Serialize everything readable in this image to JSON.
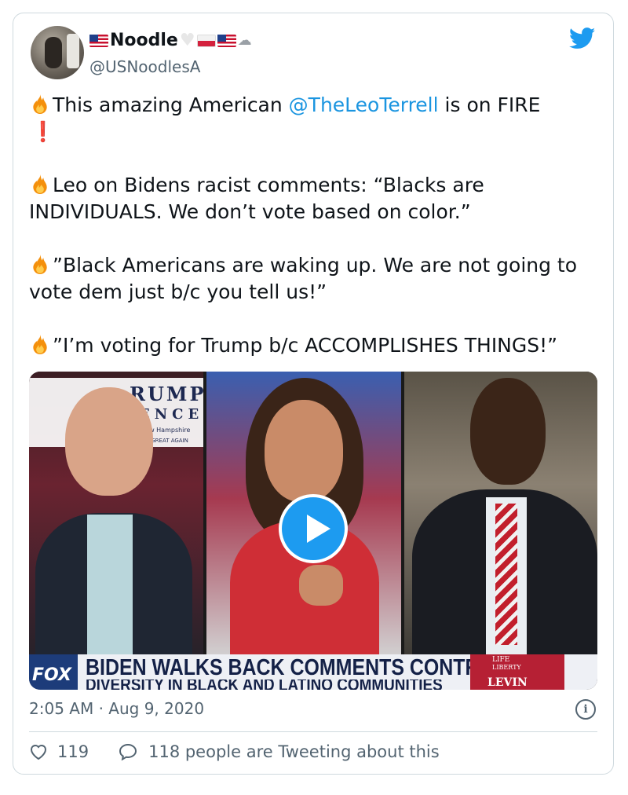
{
  "tweet": {
    "display_name": "Noodle",
    "handle": "@USNoodlesA",
    "text": {
      "p1_before": "This amazing American ",
      "p1_mention": "@TheLeoTerrell",
      "p1_after": " is on FIRE",
      "p1_emoji": "❗",
      "p2": "Leo on Bidens racist comments: “Blacks are INDIVIDUALS. We don’t vote based on color.”",
      "p3": "”Black Americans are waking up. We are not going to vote dem just b/c you tell us!”",
      "p4": "”I’m voting for Trump b/c ACCOMPLISHES THINGS!”"
    },
    "timestamp": {
      "time": "2:05 AM",
      "separator": " · ",
      "date": "Aug 9, 2020"
    },
    "likes": "119",
    "tweeting_about": "118 people are Tweeting about this"
  },
  "media": {
    "banner_top_1": "RUMP",
    "banner_top_2": "ENCE",
    "banner_top_3": "n, New Hampshire",
    "banner_top_4": "ERICA GREAT AGAIN",
    "channel_logo": "FOX",
    "headline": "BIDEN WALKS BACK COMMENTS CONTRASTING",
    "subheadline": "DIVERSITY IN BLACK AND LATINO COMMUNITIES",
    "show_line1": "LIFE",
    "show_line2": "LIBERTY",
    "show_line3": "LEVIN"
  },
  "icons": {
    "brand": "twitter-bird-icon",
    "emoji": "fire-icon",
    "play": "play-icon",
    "info": "info-icon",
    "like": "heart-icon",
    "reply": "speech-bubble-icon"
  },
  "colors": {
    "mention": "#1b95e0",
    "play_button": "#1d9bf0",
    "muted_text": "#536471",
    "border": "#cfd9de"
  }
}
